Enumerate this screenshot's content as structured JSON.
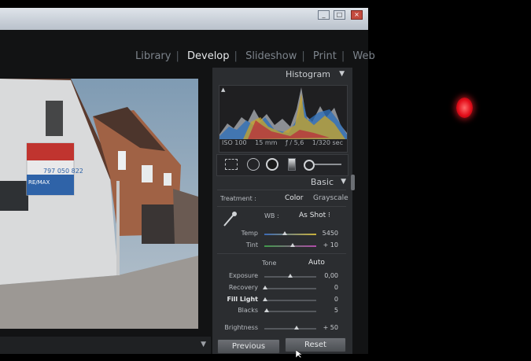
{
  "window": {
    "minimize": "_",
    "maximize": "□",
    "close": "×"
  },
  "modules": [
    {
      "label": "Library",
      "active": false
    },
    {
      "label": "Develop",
      "active": true
    },
    {
      "label": "Slideshow",
      "active": false
    },
    {
      "label": "Print",
      "active": false
    },
    {
      "label": "Web",
      "active": false
    }
  ],
  "histogram": {
    "title": "Histogram",
    "iso": "ISO 100",
    "focal": "15 mm",
    "aperture": "ƒ / 5,6",
    "shutter": "1/320 sec"
  },
  "basic": {
    "title": "Basic",
    "treatment_label": "Treatment :",
    "treatment_color": "Color",
    "treatment_grayscale": "Grayscale",
    "wb_label": "WB :",
    "wb_value": "As Shot ⁝",
    "temp_label": "Temp",
    "temp_value": "5450",
    "temp_level": 0.4,
    "tint_label": "Tint",
    "tint_value": "+ 10",
    "tint_level": 0.55,
    "tone_label": "Tone",
    "tone_auto": "Auto",
    "exposure_label": "Exposure",
    "exposure_value": "0,00",
    "exposure_level": 0.5,
    "recovery_label": "Recovery",
    "recovery_value": "0",
    "recovery_level": 0.02,
    "filllight_label": "Fill Light",
    "filllight_value": "0",
    "filllight_level": 0.02,
    "blacks_label": "Blacks",
    "blacks_value": "5",
    "blacks_level": 0.05,
    "brightness_label": "Brightness",
    "brightness_value": "+ 50",
    "brightness_level": 0.62
  },
  "footer": {
    "previous": "Previous",
    "reset": "Reset"
  },
  "photo_text": {
    "sign_number": "797 050 822",
    "sign_brand": "RE/MAX"
  },
  "colors": {
    "panel": "#2b2d30",
    "accent_text": "#e6e8ea",
    "led": "#e40e1a"
  }
}
